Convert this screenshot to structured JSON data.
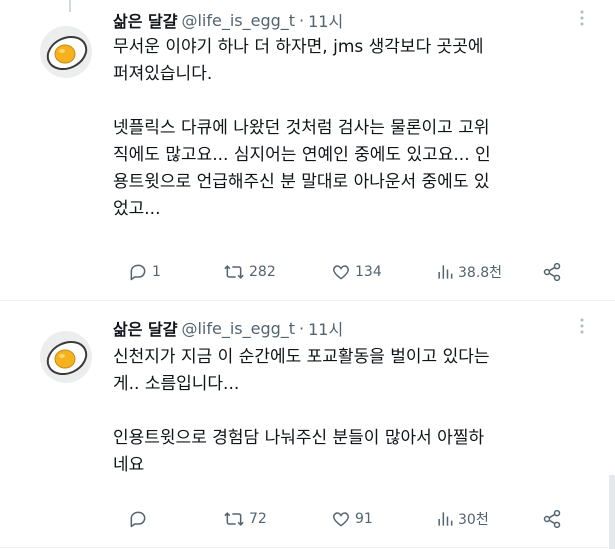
{
  "tweets": [
    {
      "display_name": "삶은 달걀",
      "handle": "@life_is_egg_t",
      "separator": "·",
      "time": "11시",
      "more_icon": "more-dots-icon",
      "text": "무서운 이야기 하나 더 하자면, jms 생각보다 곳곳에\n퍼져있습니다.\n\n넷플릭스 다큐에 나왔던 것처럼 검사는 물론이고 고위\n직에도 많고요... 심지어는 연예인 중에도 있고요... 인\n용트윗으로 언급해주신 분 말대로 아나운서 중에도 있\n었고...",
      "replies": "1",
      "retweets": "282",
      "likes": "134",
      "views": "38.8천"
    },
    {
      "display_name": "삶은 달걀",
      "handle": "@life_is_egg_t",
      "separator": "·",
      "time": "11시",
      "more_icon": "more-dots-icon",
      "text": "신천지가 지금 이 순간에도 포교활동을 벌이고 있다는\n게.. 소름입니다...\n\n인용트윗으로 경험담 나눠주신 분들이 많아서 아찔하\n네요",
      "replies": "",
      "retweets": "72",
      "likes": "91",
      "views": "30천"
    }
  ],
  "colors": {
    "text_primary": "#0f1419",
    "text_secondary": "#536471",
    "divider": "#eff3f4",
    "egg_yolk": "#f5b21e",
    "egg_white": "#ffffff"
  },
  "icons": [
    "reply-icon",
    "retweet-icon",
    "like-icon",
    "views-icon",
    "share-icon"
  ]
}
